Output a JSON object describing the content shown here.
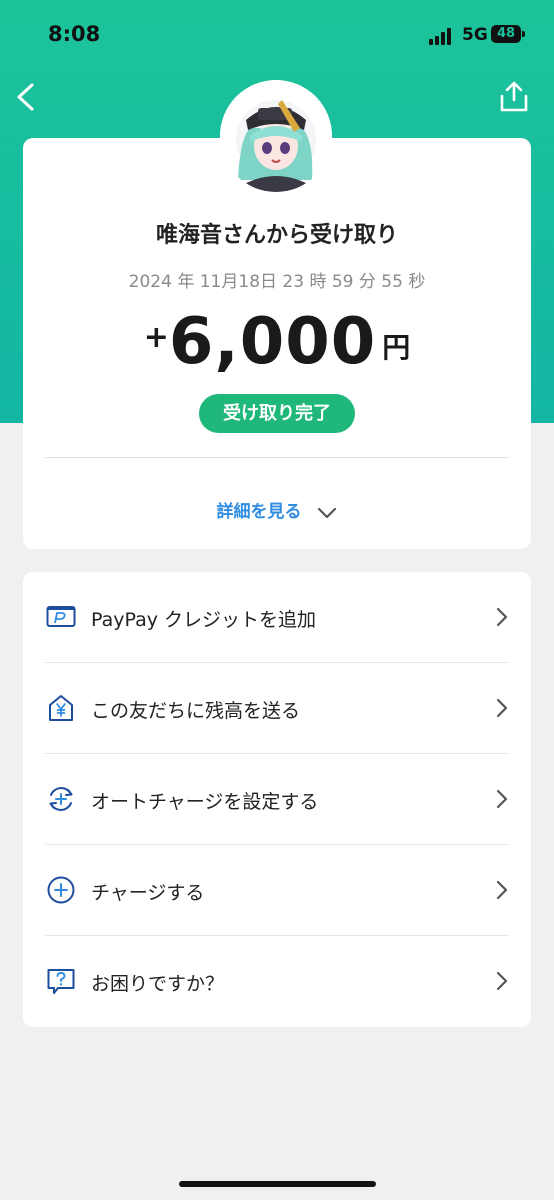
{
  "status_bar": {
    "time": "8:08",
    "network": "5G",
    "battery": "48"
  },
  "transaction": {
    "title": "唯海音さんから受け取り",
    "datetime": "2024 年 11月18日 23 時 59 分 55 秒",
    "amount_sign": "+",
    "amount": "6,000",
    "currency": "円",
    "status": "受け取り完了",
    "details_label": "詳細を見る"
  },
  "menu": {
    "items": [
      {
        "label": "PayPay クレジットを追加",
        "icon": "paypay-card-icon"
      },
      {
        "label": "この友だちに残高を送る",
        "icon": "yen-house-icon"
      },
      {
        "label": "オートチャージを設定する",
        "icon": "auto-charge-icon"
      },
      {
        "label": "チャージする",
        "icon": "plus-circle-icon"
      },
      {
        "label": "お困りですか？",
        "icon": "question-bubble-icon"
      }
    ]
  },
  "colors": {
    "header_top": "#1cc49a",
    "header_bottom": "#14b5a4",
    "status_green": "#1fb87a",
    "link_blue": "#2f8ce0",
    "icon_blue": "#1d4e9e"
  }
}
